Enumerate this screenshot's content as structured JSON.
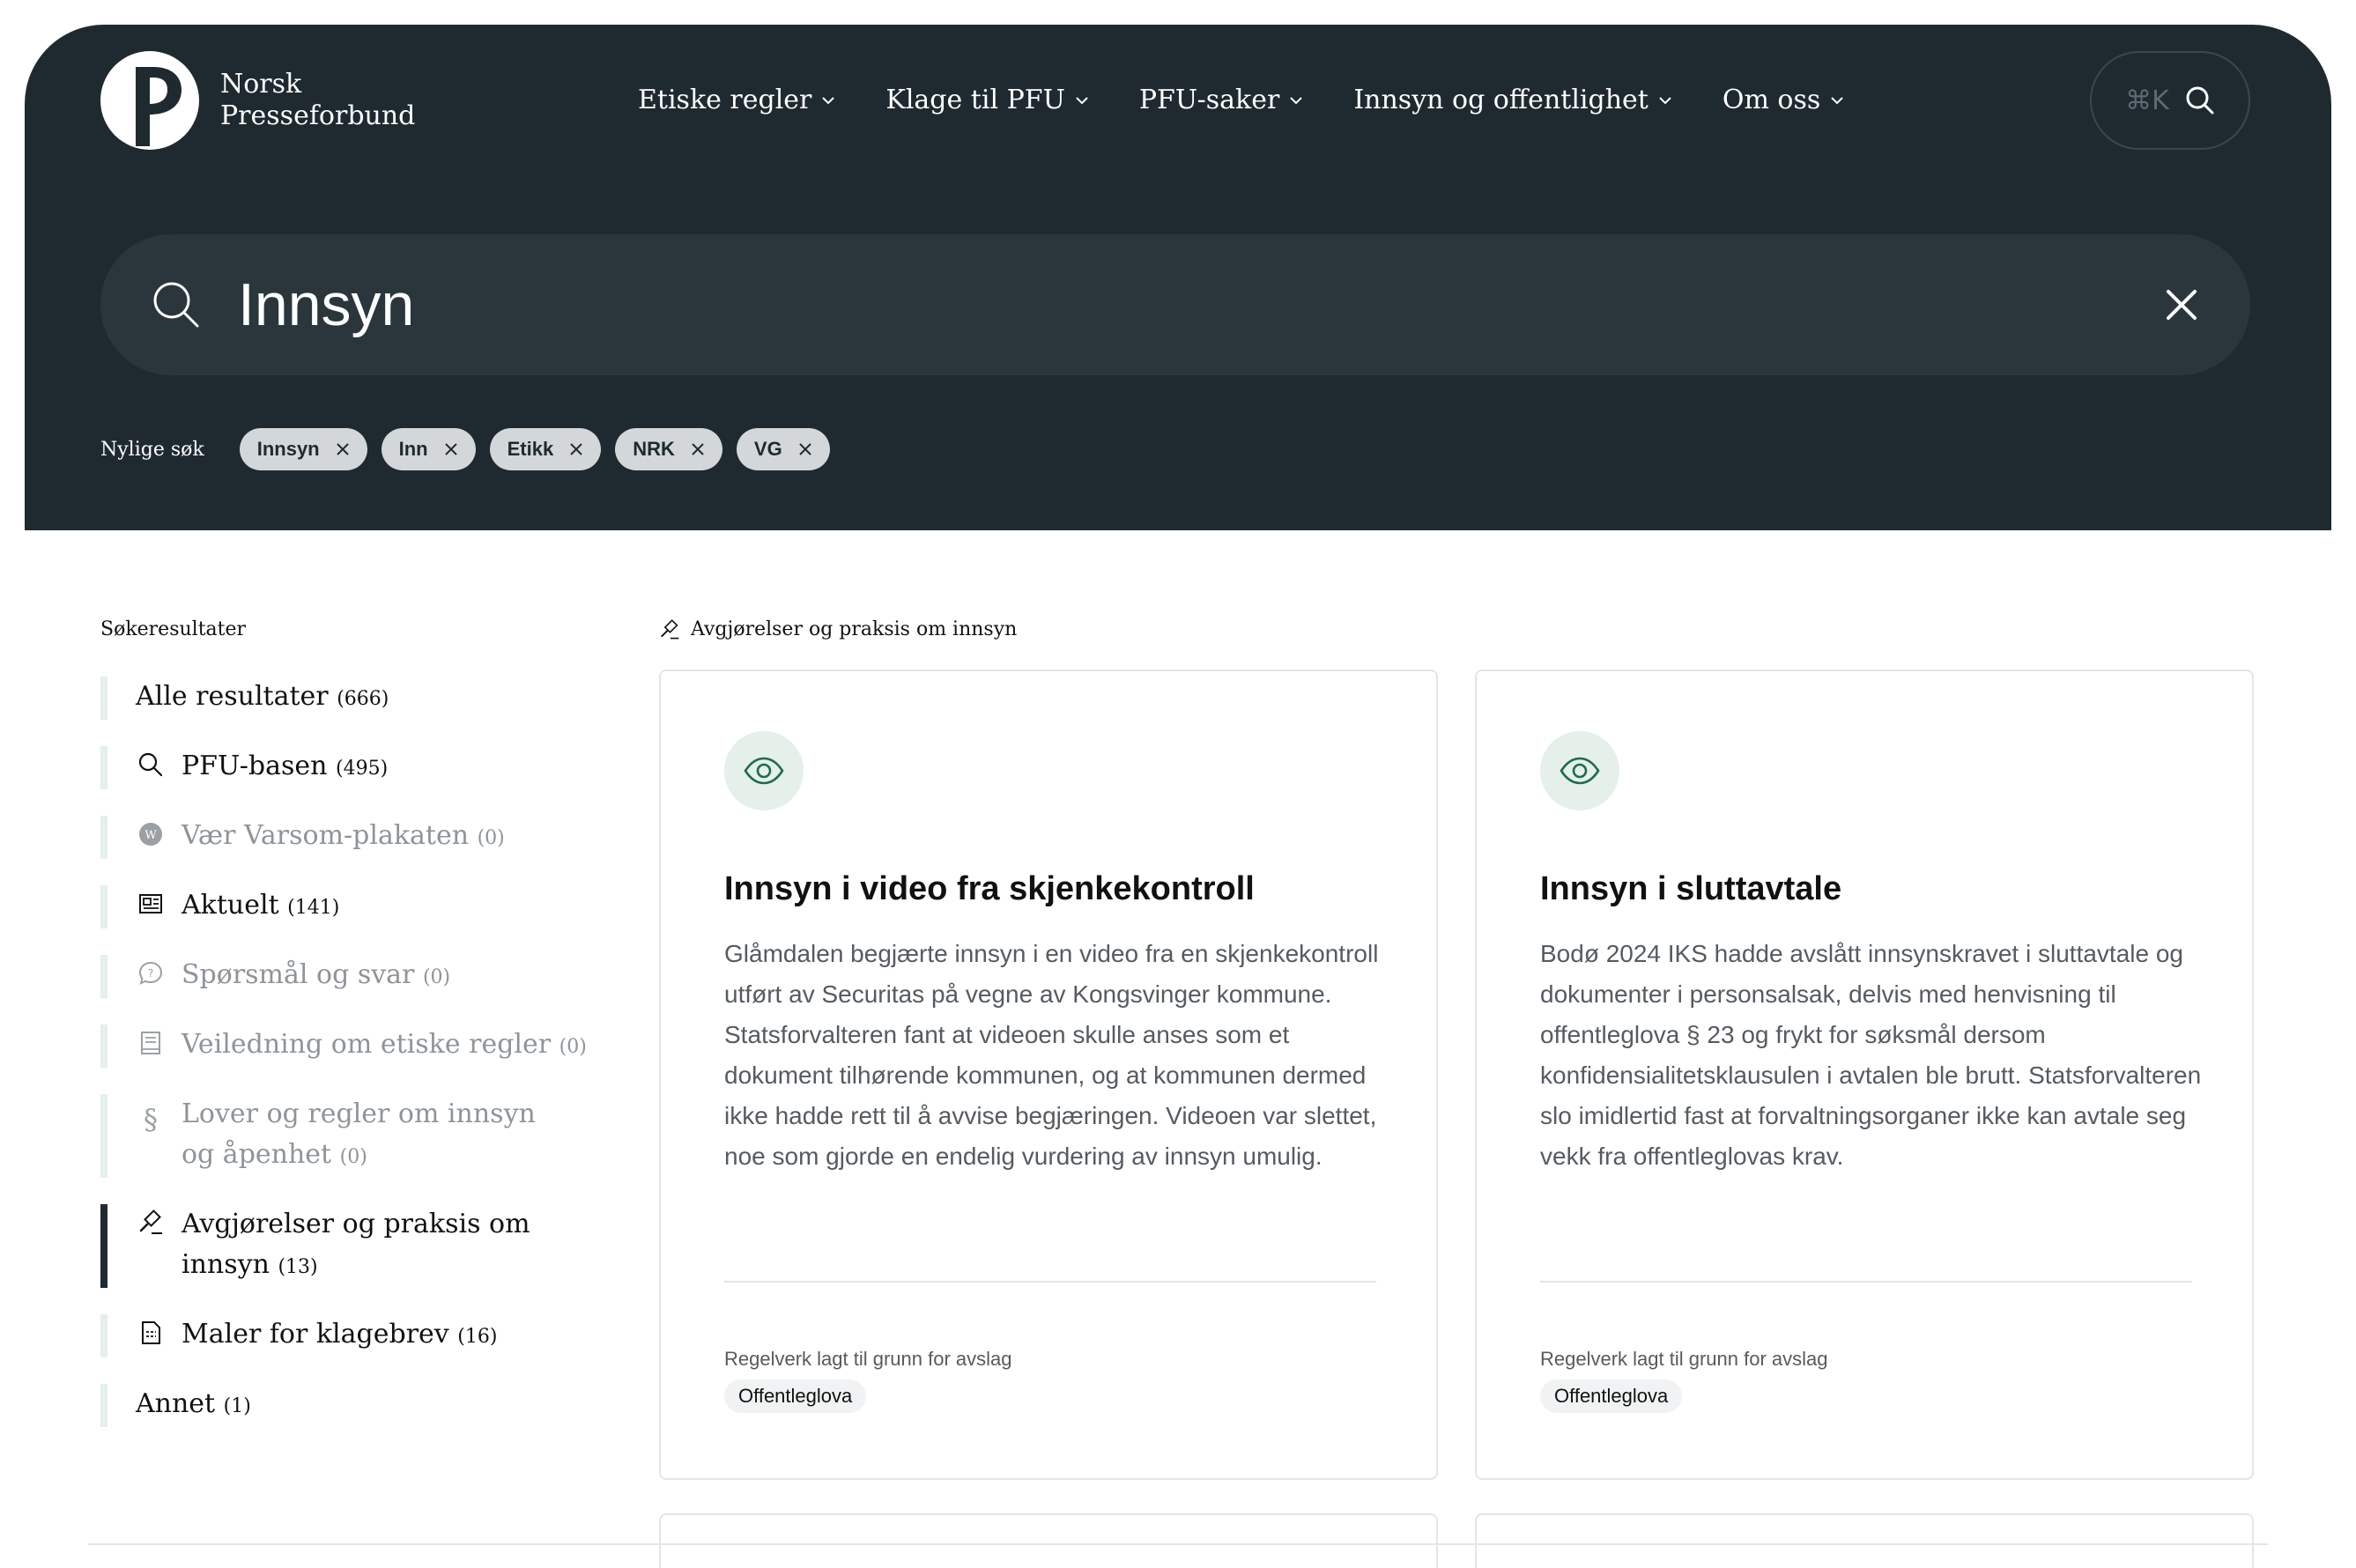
{
  "brand": {
    "line1": "Norsk",
    "line2": "Presseforbund"
  },
  "nav": [
    {
      "label": "Etiske regler"
    },
    {
      "label": "Klage til PFU"
    },
    {
      "label": "PFU-saker"
    },
    {
      "label": "Innsyn og offentlighet"
    },
    {
      "label": "Om oss"
    }
  ],
  "shortcut": {
    "label": "⌘K",
    "icon": "search-icon"
  },
  "search": {
    "query": "Innsyn",
    "icon": "search-icon",
    "clear_icon": "close-icon"
  },
  "recent": {
    "label": "Nylige søk",
    "chips": [
      "Innsyn",
      "Inn",
      "Etikk",
      "NRK",
      "VG"
    ]
  },
  "sidebar": {
    "heading": "Søkeresultater",
    "items": [
      {
        "label": "Alle resultater",
        "count": "(666)",
        "icon": "",
        "state": "enabled"
      },
      {
        "label": "PFU-basen",
        "count": "(495)",
        "icon": "search-icon",
        "state": "enabled"
      },
      {
        "label": "Vær Varsom-plakaten",
        "count": "(0)",
        "icon": "wp-icon",
        "state": "disabled"
      },
      {
        "label": "Aktuelt",
        "count": "(141)",
        "icon": "newspaper-icon",
        "state": "enabled"
      },
      {
        "label": "Spørsmål og svar",
        "count": "(0)",
        "icon": "question-bubble-icon",
        "state": "disabled"
      },
      {
        "label": "Veiledning om etiske regler",
        "count": "(0)",
        "icon": "book-icon",
        "state": "disabled"
      },
      {
        "label": "Lover og regler om innsyn og åpenhet",
        "count": "(0)",
        "icon": "paragraph-icon",
        "state": "disabled"
      },
      {
        "label": "Avgjørelser og praksis om innsyn",
        "count": "(13)",
        "icon": "gavel-icon",
        "state": "active"
      },
      {
        "label": "Maler for klagebrev",
        "count": "(16)",
        "icon": "document-icon",
        "state": "enabled"
      },
      {
        "label": "Annet",
        "count": "(1)",
        "icon": "",
        "state": "enabled"
      }
    ]
  },
  "section": {
    "title": "Avgjørelser og praksis om innsyn",
    "icon": "gavel-icon"
  },
  "cards": [
    {
      "icon": "eye-icon",
      "title": "Innsyn i video fra skjenkekontroll",
      "text": "Glåmdalen begjærte innsyn i en video fra en skjenkekontroll utført av Securitas på vegne av Kongsvinger kommune. Statsforvalteren fant at videoen skulle anses som et dokument tilhørende kommunen, og at kommunen dermed ikke hadde rett til å avvise begjæringen. Videoen var slettet, noe som gjorde en endelig vurdering av innsyn umulig.",
      "meta_label": "Regelverk lagt til grunn for avslag",
      "tag": "Offentleglova"
    },
    {
      "icon": "eye-icon",
      "title": "Innsyn i sluttavtale",
      "text": "Bodø 2024 IKS hadde avslått innsynskravet i sluttavtale og dokumenter i personsalsak, delvis med henvisning til offentleglova § 23 og frykt for søksmål dersom konfidensialitetsklausulen i avtalen ble brutt. Statsforvalteren slo imidlertid fast at forvaltningsorganer ikke kan avtale seg vekk fra offentleglovas krav.",
      "meta_label": "Regelverk lagt til grunn for avslag",
      "tag": "Offentleglova"
    }
  ],
  "colors": {
    "header_bg": "#1f2a30",
    "search_bg": "#2b363c",
    "accent_green": "#1f6b4f",
    "soft_green": "#e4f0e9"
  }
}
